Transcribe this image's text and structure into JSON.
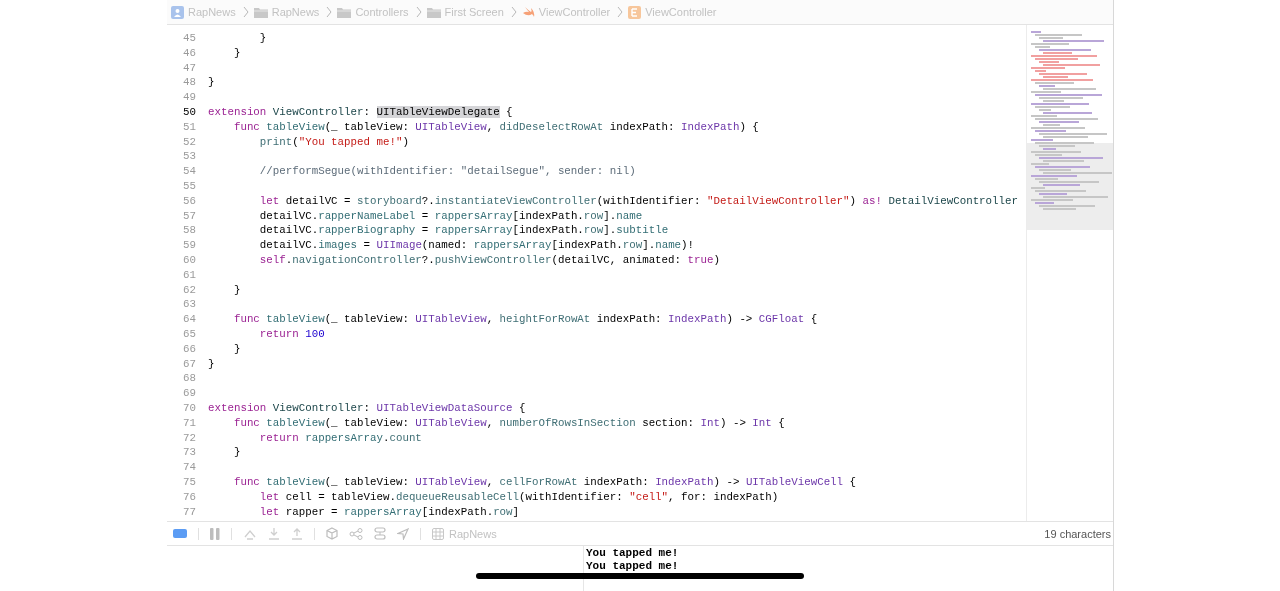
{
  "breadcrumb": [
    {
      "kind": "app",
      "label": "RapNews"
    },
    {
      "kind": "folder",
      "label": "RapNews"
    },
    {
      "kind": "folder",
      "label": "Controllers"
    },
    {
      "kind": "folder",
      "label": "First Screen"
    },
    {
      "kind": "swift",
      "label": "ViewController"
    },
    {
      "kind": "class",
      "label": "ViewController"
    }
  ],
  "code": [
    {
      "n": "45",
      "current": false,
      "tokens": [
        {
          "kind": "plain",
          "text": "        }"
        }
      ]
    },
    {
      "n": "46",
      "current": false,
      "tokens": [
        {
          "kind": "plain",
          "text": "    }"
        }
      ]
    },
    {
      "n": "47",
      "current": false
    },
    {
      "n": "48",
      "current": false,
      "tokens": [
        {
          "kind": "plain",
          "text": "}"
        }
      ]
    },
    {
      "n": "49",
      "current": false
    },
    {
      "n": "50",
      "current": true,
      "tokens": [
        {
          "kind": "keyword",
          "text": "extension"
        },
        {
          "kind": "project_type",
          "text": " ViewController"
        },
        {
          "kind": "plain",
          "text": ": "
        },
        {
          "kind": "selected",
          "text": "UITableViewDelegate"
        },
        {
          "kind": "plain",
          "text": " {"
        }
      ]
    },
    {
      "n": "51",
      "current": false,
      "tokens": [
        {
          "kind": "keyword",
          "text": "    func"
        },
        {
          "kind": "project_member",
          "text": " tableView"
        },
        {
          "kind": "plain",
          "text": "(_ tableView: "
        },
        {
          "kind": "type",
          "text": "UITableView"
        },
        {
          "kind": "plain",
          "text": ", "
        },
        {
          "kind": "member",
          "text": "didDeselectRowAt"
        },
        {
          "kind": "plain",
          "text": " indexPath: "
        },
        {
          "kind": "type",
          "text": "IndexPath"
        },
        {
          "kind": "plain",
          "text": ") {"
        }
      ]
    },
    {
      "n": "52",
      "current": false,
      "tokens": [
        {
          "kind": "member",
          "text": "        print"
        },
        {
          "kind": "plain",
          "text": "("
        },
        {
          "kind": "string",
          "text": "\"You tapped me!\""
        },
        {
          "kind": "plain",
          "text": ")"
        }
      ]
    },
    {
      "n": "53",
      "current": false
    },
    {
      "n": "54",
      "current": false,
      "tokens": [
        {
          "kind": "comment",
          "text": "        //performSegue(withIdentifier: \"detailSegue\", sender: nil)"
        }
      ]
    },
    {
      "n": "55",
      "current": false
    },
    {
      "n": "56",
      "current": false,
      "tokens": [
        {
          "kind": "keyword",
          "text": "        let"
        },
        {
          "kind": "plain",
          "text": " detailVC = "
        },
        {
          "kind": "member",
          "text": "storyboard"
        },
        {
          "kind": "plain",
          "text": "?."
        },
        {
          "kind": "member",
          "text": "instantiateViewController"
        },
        {
          "kind": "plain",
          "text": "(withIdentifier: "
        },
        {
          "kind": "string",
          "text": "\"DetailViewController\""
        },
        {
          "kind": "plain",
          "text": ") "
        },
        {
          "kind": "keyword",
          "text": "as!"
        },
        {
          "kind": "project_type",
          "text": " DetailViewController"
        }
      ]
    },
    {
      "n": "57",
      "current": false,
      "tokens": [
        {
          "kind": "plain",
          "text": "        detailVC."
        },
        {
          "kind": "project_member",
          "text": "rapperNameLabel"
        },
        {
          "kind": "plain",
          "text": " = "
        },
        {
          "kind": "project_member",
          "text": "rappersArray"
        },
        {
          "kind": "plain",
          "text": "[indexPath."
        },
        {
          "kind": "member",
          "text": "row"
        },
        {
          "kind": "plain",
          "text": "]."
        },
        {
          "kind": "project_member",
          "text": "name"
        }
      ]
    },
    {
      "n": "58",
      "current": false,
      "tokens": [
        {
          "kind": "plain",
          "text": "        detailVC."
        },
        {
          "kind": "project_member",
          "text": "rapperBiography"
        },
        {
          "kind": "plain",
          "text": " = "
        },
        {
          "kind": "project_member",
          "text": "rappersArray"
        },
        {
          "kind": "plain",
          "text": "[indexPath."
        },
        {
          "kind": "member",
          "text": "row"
        },
        {
          "kind": "plain",
          "text": "]."
        },
        {
          "kind": "project_member",
          "text": "subtitle"
        }
      ]
    },
    {
      "n": "59",
      "current": false,
      "tokens": [
        {
          "kind": "plain",
          "text": "        detailVC."
        },
        {
          "kind": "project_member",
          "text": "images"
        },
        {
          "kind": "plain",
          "text": " = "
        },
        {
          "kind": "type",
          "text": "UIImage"
        },
        {
          "kind": "plain",
          "text": "(named: "
        },
        {
          "kind": "project_member",
          "text": "rappersArray"
        },
        {
          "kind": "plain",
          "text": "[indexPath."
        },
        {
          "kind": "member",
          "text": "row"
        },
        {
          "kind": "plain",
          "text": "]."
        },
        {
          "kind": "project_member",
          "text": "name"
        },
        {
          "kind": "plain",
          "text": ")!"
        }
      ]
    },
    {
      "n": "60",
      "current": false,
      "tokens": [
        {
          "kind": "keyword",
          "text": "        self"
        },
        {
          "kind": "plain",
          "text": "."
        },
        {
          "kind": "member",
          "text": "navigationController"
        },
        {
          "kind": "plain",
          "text": "?."
        },
        {
          "kind": "member",
          "text": "pushViewController"
        },
        {
          "kind": "plain",
          "text": "(detailVC, animated: "
        },
        {
          "kind": "keyword",
          "text": "true"
        },
        {
          "kind": "plain",
          "text": ")"
        }
      ]
    },
    {
      "n": "61",
      "current": false
    },
    {
      "n": "62",
      "current": false,
      "tokens": [
        {
          "kind": "plain",
          "text": "    }"
        }
      ]
    },
    {
      "n": "63",
      "current": false
    },
    {
      "n": "64",
      "current": false,
      "tokens": [
        {
          "kind": "keyword",
          "text": "    func"
        },
        {
          "kind": "project_member",
          "text": " tableView"
        },
        {
          "kind": "plain",
          "text": "(_ tableView: "
        },
        {
          "kind": "type",
          "text": "UITableView"
        },
        {
          "kind": "plain",
          "text": ", "
        },
        {
          "kind": "member",
          "text": "heightForRowAt"
        },
        {
          "kind": "plain",
          "text": " indexPath: "
        },
        {
          "kind": "type",
          "text": "IndexPath"
        },
        {
          "kind": "plain",
          "text": ") -> "
        },
        {
          "kind": "type",
          "text": "CGFloat"
        },
        {
          "kind": "plain",
          "text": " {"
        }
      ]
    },
    {
      "n": "65",
      "current": false,
      "tokens": [
        {
          "kind": "keyword",
          "text": "        return"
        },
        {
          "kind": "number",
          "text": " 100"
        }
      ]
    },
    {
      "n": "66",
      "current": false,
      "tokens": [
        {
          "kind": "plain",
          "text": "    }"
        }
      ]
    },
    {
      "n": "67",
      "current": false,
      "tokens": [
        {
          "kind": "plain",
          "text": "}"
        }
      ]
    },
    {
      "n": "68",
      "current": false
    },
    {
      "n": "69",
      "current": false
    },
    {
      "n": "70",
      "current": false,
      "tokens": [
        {
          "kind": "keyword",
          "text": "extension"
        },
        {
          "kind": "project_type",
          "text": " ViewController"
        },
        {
          "kind": "plain",
          "text": ": "
        },
        {
          "kind": "type",
          "text": "UITableViewDataSource"
        },
        {
          "kind": "plain",
          "text": " {"
        }
      ]
    },
    {
      "n": "71",
      "current": false,
      "tokens": [
        {
          "kind": "keyword",
          "text": "    func"
        },
        {
          "kind": "project_member",
          "text": " tableView"
        },
        {
          "kind": "plain",
          "text": "(_ tableView: "
        },
        {
          "kind": "type",
          "text": "UITableView"
        },
        {
          "kind": "plain",
          "text": ", "
        },
        {
          "kind": "member",
          "text": "numberOfRowsInSection"
        },
        {
          "kind": "plain",
          "text": " section: "
        },
        {
          "kind": "type",
          "text": "Int"
        },
        {
          "kind": "plain",
          "text": ") -> "
        },
        {
          "kind": "type",
          "text": "Int"
        },
        {
          "kind": "plain",
          "text": " {"
        }
      ]
    },
    {
      "n": "72",
      "current": false,
      "tokens": [
        {
          "kind": "keyword",
          "text": "        return"
        },
        {
          "kind": "project_member",
          "text": " rappersArray"
        },
        {
          "kind": "plain",
          "text": "."
        },
        {
          "kind": "member",
          "text": "count"
        }
      ]
    },
    {
      "n": "73",
      "current": false,
      "tokens": [
        {
          "kind": "plain",
          "text": "    }"
        }
      ]
    },
    {
      "n": "74",
      "current": false
    },
    {
      "n": "75",
      "current": false,
      "tokens": [
        {
          "kind": "keyword",
          "text": "    func"
        },
        {
          "kind": "project_member",
          "text": " tableView"
        },
        {
          "kind": "plain",
          "text": "(_ tableView: "
        },
        {
          "kind": "type",
          "text": "UITableView"
        },
        {
          "kind": "plain",
          "text": ", "
        },
        {
          "kind": "member",
          "text": "cellForRowAt"
        },
        {
          "kind": "plain",
          "text": " indexPath: "
        },
        {
          "kind": "type",
          "text": "IndexPath"
        },
        {
          "kind": "plain",
          "text": ") -> "
        },
        {
          "kind": "type",
          "text": "UITableViewCell"
        },
        {
          "kind": "plain",
          "text": " {"
        }
      ]
    },
    {
      "n": "76",
      "current": false,
      "tokens": [
        {
          "kind": "keyword",
          "text": "        let"
        },
        {
          "kind": "plain",
          "text": " cell = tableView."
        },
        {
          "kind": "member",
          "text": "dequeueReusableCell"
        },
        {
          "kind": "plain",
          "text": "(withIdentifier: "
        },
        {
          "kind": "string",
          "text": "\"cell\""
        },
        {
          "kind": "plain",
          "text": ", for: indexPath)"
        }
      ]
    },
    {
      "n": "77",
      "current": false,
      "tokens": [
        {
          "kind": "keyword",
          "text": "        let"
        },
        {
          "kind": "plain",
          "text": " rapper = "
        },
        {
          "kind": "project_member",
          "text": "rappersArray"
        },
        {
          "kind": "plain",
          "text": "[indexPath."
        },
        {
          "kind": "member",
          "text": "row"
        },
        {
          "kind": "plain",
          "text": "]"
        }
      ]
    }
  ],
  "debug_bar": {
    "target": "RapNews",
    "status": "19 characters"
  },
  "console": [
    "You tapped me!",
    "You tapped me!"
  ]
}
